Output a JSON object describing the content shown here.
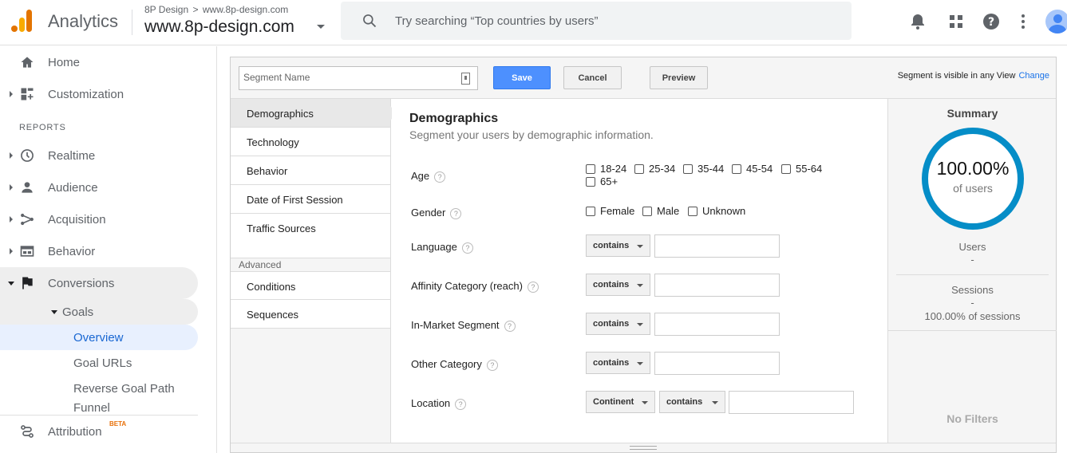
{
  "header": {
    "app_title": "Analytics",
    "account_crumb_parent": "8P Design",
    "account_crumb_child": "www.8p-design.com",
    "account_name": "www.8p-design.com",
    "search_placeholder": "Try searching “Top countries by users”"
  },
  "sidebar": {
    "home": "Home",
    "customization": "Customization",
    "reports_label": "REPORTS",
    "realtime": "Realtime",
    "audience": "Audience",
    "acquisition": "Acquisition",
    "behavior": "Behavior",
    "conversions": "Conversions",
    "goals": "Goals",
    "overview": "Overview",
    "goal_urls": "Goal URLs",
    "reverse_goal_path": "Reverse Goal Path",
    "funnel": "Funnel",
    "attribution": "Attribution",
    "attribution_badge": "BETA"
  },
  "toolbar": {
    "segment_name_placeholder": "Segment Name",
    "save_label": "Save",
    "cancel_label": "Cancel",
    "preview_label": "Preview",
    "visibility_text": "Segment is visible in any View",
    "change_label": "Change"
  },
  "tabs": {
    "demographics": "Demographics",
    "technology": "Technology",
    "behavior": "Behavior",
    "date_first_session": "Date of First Session",
    "traffic_sources": "Traffic Sources",
    "advanced_label": "Advanced",
    "conditions": "Conditions",
    "sequences": "Sequences"
  },
  "content": {
    "title": "Demographics",
    "subtitle": "Segment your users by demographic information.",
    "help_glyph": "?",
    "age_label": "Age",
    "age_options": [
      "18-24",
      "25-34",
      "35-44",
      "45-54",
      "55-64",
      "65+"
    ],
    "gender_label": "Gender",
    "gender_options": [
      "Female",
      "Male",
      "Unknown"
    ],
    "language_label": "Language",
    "affinity_label": "Affinity Category (reach)",
    "in_market_label": "In-Market Segment",
    "other_category_label": "Other Category",
    "location_label": "Location",
    "contains": "contains",
    "continent": "Continent"
  },
  "summary": {
    "title": "Summary",
    "percent": "100.00%",
    "of_users": "of users",
    "users_label": "Users",
    "users_value": "-",
    "sessions_label": "Sessions",
    "sessions_value": "-",
    "sessions_pct": "100.00% of sessions",
    "no_filters": "No Filters"
  },
  "colors": {
    "accent_blue": "#1a73e8",
    "save_blue": "#4d90fe",
    "ring_blue": "#058dc7",
    "logo_orange": "#e37400",
    "logo_yellow": "#f9ab00"
  }
}
